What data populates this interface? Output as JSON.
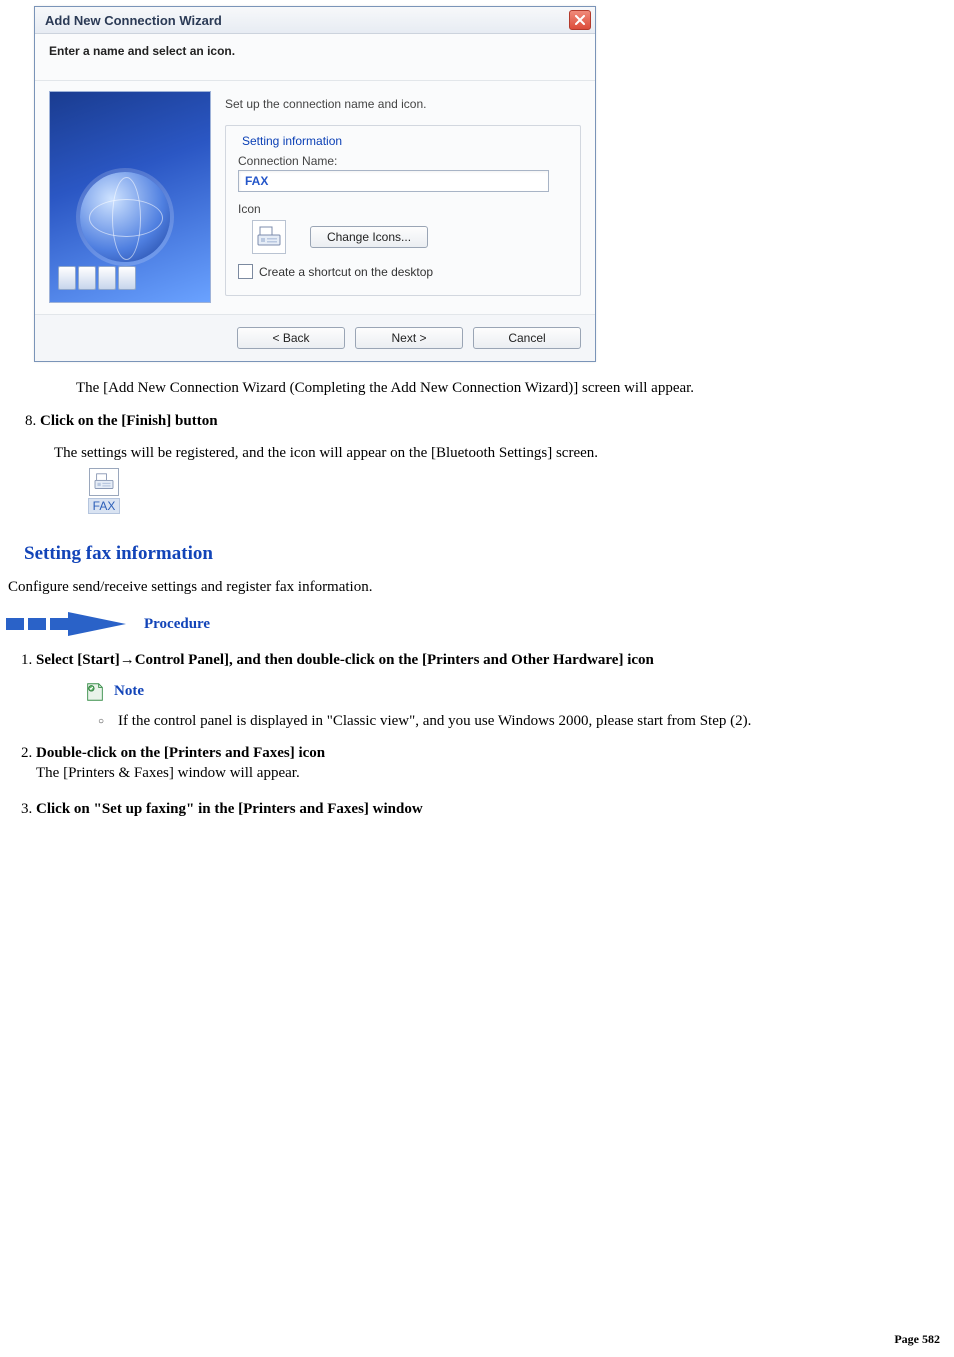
{
  "dialog": {
    "title": "Add New Connection Wizard",
    "subheading": "Enter a name and select an icon.",
    "setup_line": "Set up the connection name and icon.",
    "fieldset_legend": "Setting information",
    "conn_name_label": "Connection Name:",
    "conn_name_value": "FAX",
    "icon_label": "Icon",
    "change_icons_btn": "Change Icons...",
    "shortcut_checkbox_label": "Create a shortcut on the desktop",
    "shortcut_checked": false,
    "buttons": {
      "back": "< Back",
      "next": "Next >",
      "cancel": "Cancel"
    }
  },
  "text_after_dialog": "The [Add New Connection Wizard (Completing the Add New Connection Wizard)] screen will appear.",
  "step8": {
    "num": "8.",
    "text": "Click on the [Finish] button"
  },
  "registered_line": "The settings will be registered, and the icon will appear on the [Bluetooth Settings] screen.",
  "bt_icon_caption": "FAX",
  "section_heading": "Setting fax information",
  "section_intro": "Configure send/receive settings and register fax information.",
  "procedure_label": "Procedure",
  "steps": {
    "s1": "Select [Start]→Control Panel], and then double-click on the [Printers and Other Hardware] icon",
    "note_label": "Note",
    "note_item": "If the control panel is displayed in \"Classic view\", and you use Windows 2000, please start from Step (2).",
    "s2_bold": "Double-click on the [Printers and Faxes] icon",
    "s2_sub": "The [Printers & Faxes] window will appear.",
    "s3": "Click on \"Set up faxing\" in the [Printers and Faxes] window"
  },
  "page_number": "Page 582"
}
